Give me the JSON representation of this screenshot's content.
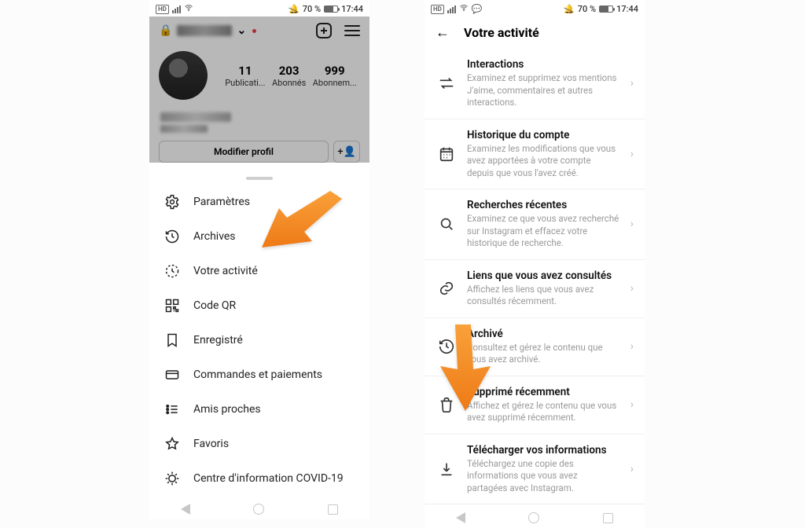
{
  "status_bar": {
    "hd": "HD",
    "battery_text": "70 %",
    "time": "17:44"
  },
  "left": {
    "profile": {
      "posts": {
        "count": "11",
        "label": "Publicati..."
      },
      "followers": {
        "count": "203",
        "label": "Abonnés"
      },
      "following": {
        "count": "999",
        "label": "Abonnem..."
      },
      "edit_label": "Modifier profil"
    },
    "menu": [
      {
        "key": "settings",
        "label": "Paramètres"
      },
      {
        "key": "archive",
        "label": "Archives"
      },
      {
        "key": "activity",
        "label": "Votre activité"
      },
      {
        "key": "qr",
        "label": "Code QR"
      },
      {
        "key": "saved",
        "label": "Enregistré"
      },
      {
        "key": "orders",
        "label": "Commandes et paiements"
      },
      {
        "key": "close-friends",
        "label": "Amis proches"
      },
      {
        "key": "favorites",
        "label": "Favoris"
      },
      {
        "key": "covid",
        "label": "Centre d'information COVID-19"
      }
    ]
  },
  "right": {
    "title": "Votre activité",
    "items": [
      {
        "key": "interactions",
        "title": "Interactions",
        "desc": "Examinez et supprimez vos mentions J'aime, commentaires et autres interactions."
      },
      {
        "key": "history",
        "title": "Historique du compte",
        "desc": "Examinez les modifications que vous avez apportées à votre compte depuis que vous l'avez créé."
      },
      {
        "key": "searches",
        "title": "Recherches récentes",
        "desc": "Examinez ce que vous avez recherché sur Instagram et effacez votre historique de recherche."
      },
      {
        "key": "links",
        "title": "Liens que vous avez consultés",
        "desc": "Affichez les liens que vous avez consultés récemment."
      },
      {
        "key": "archived",
        "title": "Archivé",
        "desc": "Consultez et gérez le contenu que vous avez archivé."
      },
      {
        "key": "deleted",
        "title": "Supprimé récemment",
        "desc": "Affichez et gérez le contenu que vous avez supprimé récemment."
      },
      {
        "key": "download",
        "title": "Télécharger vos informations",
        "desc": "Téléchargez une copie des informations que vous avez partagées avec Instagram."
      }
    ]
  }
}
